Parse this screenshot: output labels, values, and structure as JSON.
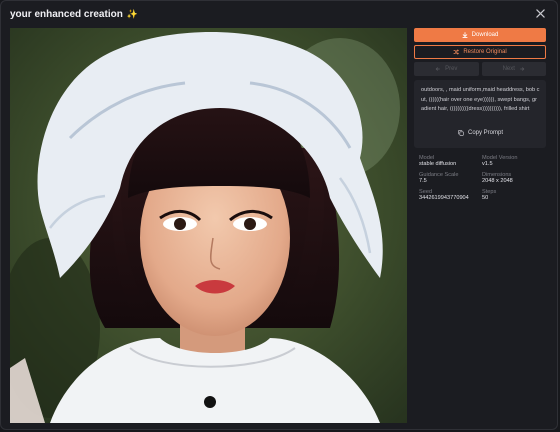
{
  "dialog": {
    "title": "your enhanced creation",
    "title_icon": "sparkles-icon"
  },
  "actions": {
    "download": "Download",
    "restore": "Restore Original",
    "previous": "Prev",
    "next": "Next"
  },
  "prompt": {
    "text": "outdoors, , maid uniform,maid headdress, bob cut, ((((((hair over one eye)))))), swept bangs, gradient hair, ((((((((((dress)))))))))), frilled shirt",
    "copy_label": "Copy Prompt"
  },
  "metadata": {
    "model_label": "Model",
    "model_value": "stable diffusion",
    "model_version_label": "Model Version",
    "model_version_value": "v1.5",
    "guidance_label": "Guidance Scale",
    "guidance_value": "7.5",
    "dimensions_label": "Dimensions",
    "dimensions_value": "2048 x 2048",
    "seed_label": "Seed",
    "seed_value": "3442619943770904",
    "steps_label": "Steps",
    "steps_value": "50"
  },
  "colors": {
    "accent": "#ef7a45",
    "background": "#1b1c21",
    "panel": "#24252b"
  }
}
